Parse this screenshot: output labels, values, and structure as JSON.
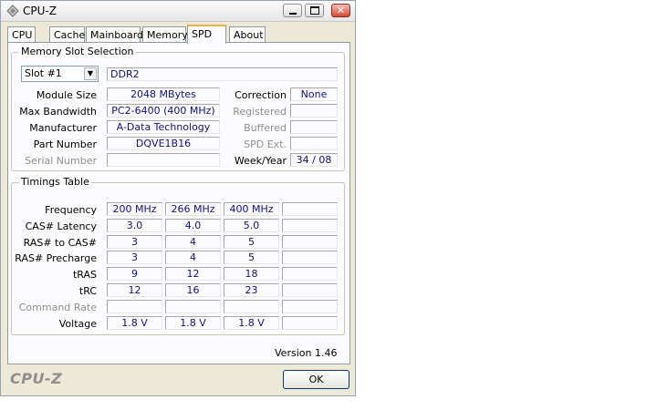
{
  "window": {
    "title": "CPU-Z"
  },
  "tabs": [
    "CPU",
    "Cache",
    "Mainboard",
    "Memory",
    "SPD",
    "About"
  ],
  "active_tab": "SPD",
  "memory_slot": {
    "group_title": "Memory Slot Selection",
    "slot_value": "Slot #1",
    "memory_type": "DDR2",
    "module_size_label": "Module Size",
    "module_size": "2048 MBytes",
    "max_bandwidth_label": "Max Bandwidth",
    "max_bandwidth": "PC2-6400 (400 MHz)",
    "manufacturer_label": "Manufacturer",
    "manufacturer": "A-Data Technology",
    "part_number_label": "Part Number",
    "part_number": "DQVE1B16",
    "serial_number_label": "Serial Number",
    "serial_number": "",
    "correction_label": "Correction",
    "correction": "None",
    "registered_label": "Registered",
    "registered": "",
    "buffered_label": "Buffered",
    "buffered": "",
    "spd_ext_label": "SPD Ext.",
    "spd_ext": "",
    "week_year_label": "Week/Year",
    "week_year": "34 / 08"
  },
  "timings": {
    "group_title": "Timings Table",
    "rows": [
      {
        "label": "Frequency",
        "dim": false,
        "values": [
          "200 MHz",
          "266 MHz",
          "400 MHz",
          ""
        ]
      },
      {
        "label": "CAS# Latency",
        "dim": false,
        "values": [
          "3.0",
          "4.0",
          "5.0",
          ""
        ]
      },
      {
        "label": "RAS# to CAS#",
        "dim": false,
        "values": [
          "3",
          "4",
          "5",
          ""
        ]
      },
      {
        "label": "RAS# Precharge",
        "dim": false,
        "values": [
          "3",
          "4",
          "5",
          ""
        ]
      },
      {
        "label": "tRAS",
        "dim": false,
        "values": [
          "9",
          "12",
          "18",
          ""
        ]
      },
      {
        "label": "tRC",
        "dim": false,
        "values": [
          "12",
          "16",
          "23",
          ""
        ]
      },
      {
        "label": "Command Rate",
        "dim": true,
        "values": [
          "",
          "",
          "",
          ""
        ]
      },
      {
        "label": "Voltage",
        "dim": false,
        "values": [
          "1.8 V",
          "1.8 V",
          "1.8 V",
          ""
        ]
      }
    ]
  },
  "footer": {
    "version": "Version 1.46",
    "brand": "CPU-Z",
    "ok_label": "OK"
  }
}
